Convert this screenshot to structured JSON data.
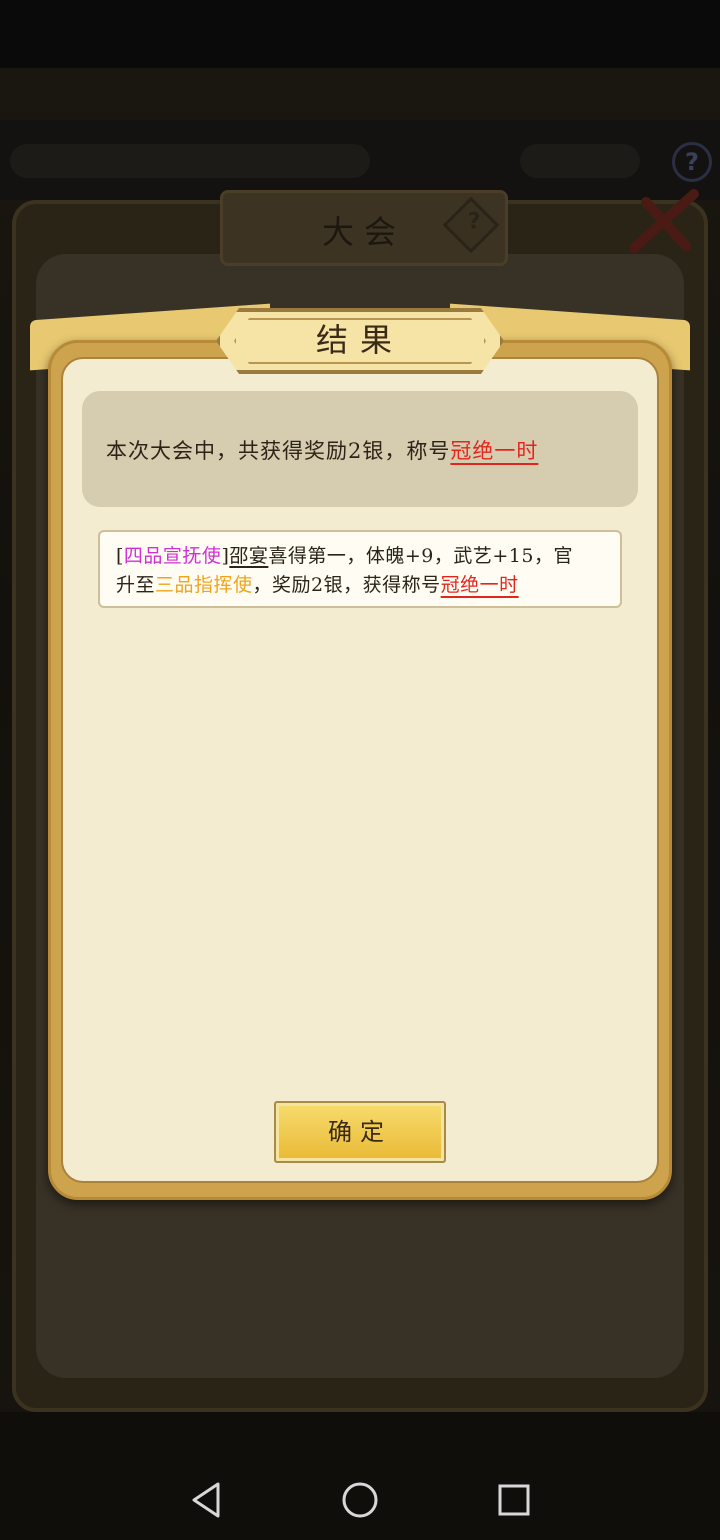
{
  "background": {
    "panel_title": "大会",
    "help_icon": "question-mark-icon",
    "close_icon": "close-x-icon"
  },
  "dialog": {
    "title": "结果",
    "summary": {
      "prefix": "本次大会中，共获得奖励2银，称号",
      "honor_title": "冠绝一时"
    },
    "detail": {
      "line1_bracket_open": "[",
      "line1_old_rank": "四品宣抚使",
      "line1_bracket_close": "]",
      "line1_name": "邵宴",
      "line1_rest": "喜得第一，体魄+9，武艺+15，官",
      "line2_prefix": "升至",
      "line2_new_rank": "三品指挥使",
      "line2_mid": "，奖励2银，获得称号",
      "line2_honor_title": "冠绝一时"
    },
    "confirm_label": "确定"
  },
  "colors": {
    "honor_red": "#e3261d",
    "old_rank_purple": "#d02fd9",
    "new_rank_gold": "#f2a31a"
  },
  "nav": {
    "back_icon": "back-triangle-icon",
    "home_icon": "home-circle-icon",
    "recent_icon": "recent-square-icon"
  }
}
